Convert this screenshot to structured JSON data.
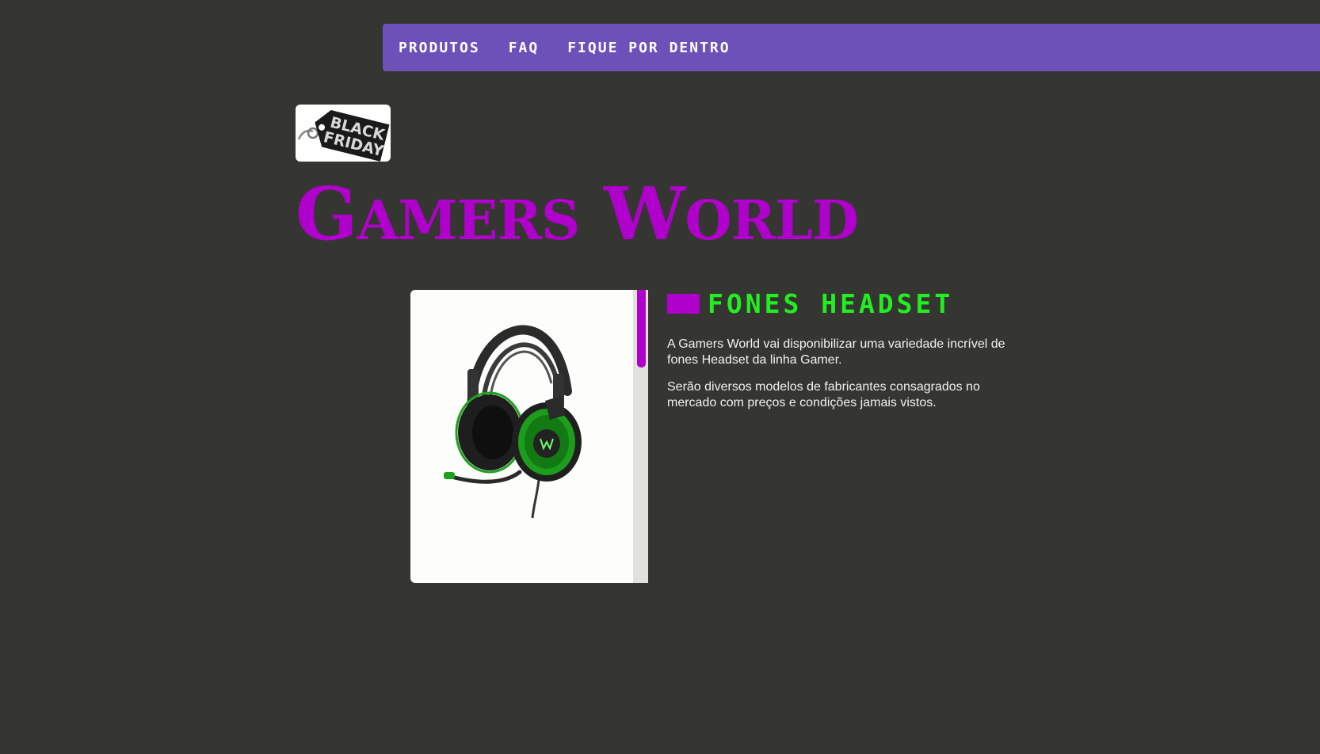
{
  "nav": {
    "items": [
      {
        "label": "PRODUTOS"
      },
      {
        "label": "FAQ"
      },
      {
        "label": "FIQUE POR DENTRO"
      }
    ]
  },
  "logo": {
    "line1": "BLACK",
    "line2": "FRIDAY"
  },
  "hero": {
    "title_cap1": "G",
    "title_rest1": "AMERS",
    "title_cap2": "W",
    "title_rest2": "ORLD"
  },
  "product": {
    "image_icon": "headset-image",
    "scrollbar_position": 0
  },
  "section": {
    "heading": "FONES HEADSET",
    "paragraphs": [
      "A Gamers World vai disponibilizar uma variedade incrível de fones Headset da linha Gamer.",
      "Serão diversos modelos de fabricantes consagrados no mercado com preços e condições jamais vistos."
    ]
  },
  "colors": {
    "background": "#353531",
    "nav": "#6e50b9",
    "accent": "#b000cc",
    "heading": "#22ee22",
    "text": "#f2f2f2"
  }
}
